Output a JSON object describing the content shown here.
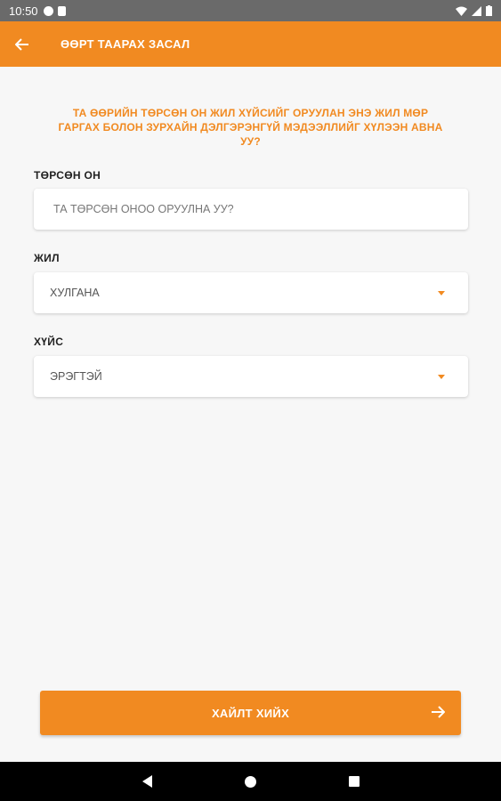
{
  "status_bar": {
    "time": "10:50",
    "icons": [
      "notification-icon",
      "sd-card-icon",
      "wifi-icon",
      "signal-icon",
      "battery-icon"
    ]
  },
  "app_bar": {
    "title": "ӨӨРТ ТААРАХ ЗАСАЛ",
    "back_icon": "arrow-left-icon",
    "color": "#f18a21"
  },
  "intro": {
    "text": "ТА ӨӨРИЙН ТӨРСӨН ОН ЖИЛ ХҮЙСИЙГ ОРУУЛАН ЭНЭ ЖИЛ МӨР ГАРГАХ БОЛОН ЗУРХАЙН ДЭЛГЭРЭНГҮЙ МЭДЭЭЛЛИЙГ ХҮЛЭЭН АВНА УУ?"
  },
  "form": {
    "birth_year": {
      "label": "ТӨРСӨН ОН",
      "placeholder": "ТА ТӨРСӨН ОНОО ОРУУЛНА УУ?"
    },
    "year": {
      "label": "ЖИЛ",
      "value": "ХУЛГАНА"
    },
    "gender": {
      "label": "ХҮЙС",
      "value": "ЭРЭГТЭЙ"
    }
  },
  "search_button": {
    "label": "ХАЙЛТ ХИЙХ",
    "icon": "arrow-right-icon"
  },
  "nav_bar": {
    "icons": [
      "nav-back-icon",
      "nav-home-icon",
      "nav-recent-icon"
    ]
  }
}
